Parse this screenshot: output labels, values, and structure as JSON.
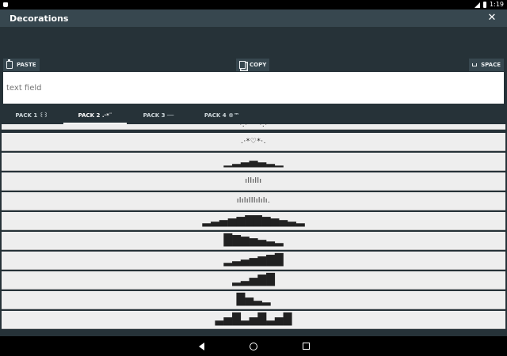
{
  "status_bar": {
    "time": "1:19"
  },
  "app_bar": {
    "title": "Decorations",
    "close_glyph": "✕"
  },
  "toolbar": {
    "paste_label": "PASTE",
    "copy_label": "COPY",
    "space_label": "SPACE"
  },
  "text_field": {
    "placeholder": "text field",
    "value": ""
  },
  "tabs": [
    {
      "label": "PACK 1 ꒰꒱",
      "selected": false
    },
    {
      "label": "PACK 2 .·*¨",
      "selected": true
    },
    {
      "label": "PACK 3 ──",
      "selected": false
    },
    {
      "label": "PACK 4 ®™",
      "selected": false
    }
  ],
  "items": [
    {
      "text": "·.·´¯`·.·"
    },
    {
      "text": ".·*♡*·."
    },
    {
      "text": "▁▂▃▄▃▂▁"
    },
    {
      "text": "ıllıllı"
    },
    {
      "text": "ılılılllılılı."
    },
    {
      "text": "▂▃▄▅▆▇▇▆▅▄▃▂"
    },
    {
      "text": "█▇▆▅▄▃▂"
    },
    {
      "text": "▂▃▄▅▆▇█"
    },
    {
      "text": "▂▃▅▇█"
    },
    {
      "text": "█▅▃▂"
    },
    {
      "text": "▃▅█▃▅█▃▅█"
    }
  ]
}
